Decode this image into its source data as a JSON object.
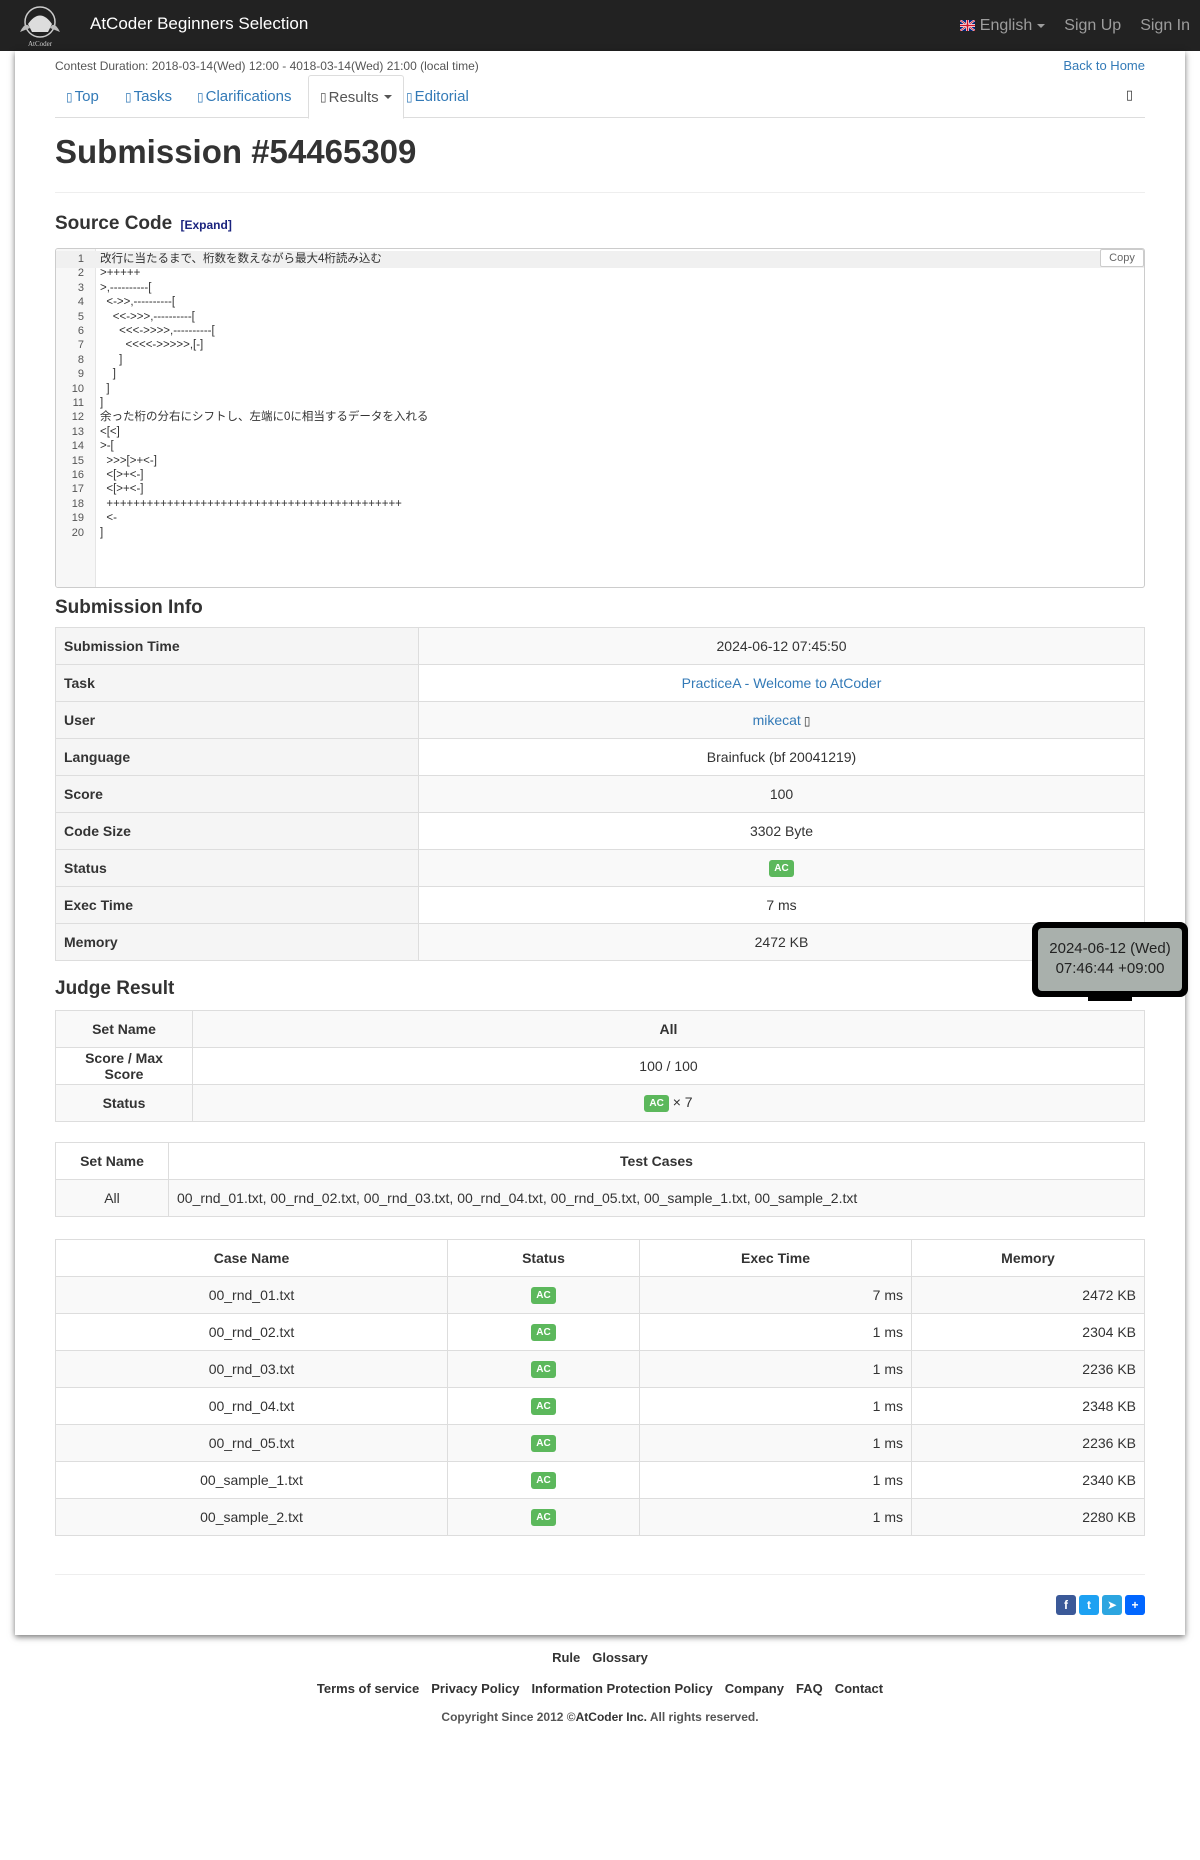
{
  "nav": {
    "brand": "AtCoder Beginners Selection",
    "logo_text": "AtCoder",
    "language": "English",
    "sign_up": "Sign Up",
    "sign_in": "Sign In"
  },
  "contest": {
    "duration": "Contest Duration: 2018-03-14(Wed) 12:00 - 4018-03-14(Wed) 21:00 (local time)",
    "back_home": "Back to Home"
  },
  "tabs": [
    {
      "label": "Top"
    },
    {
      "label": "Tasks"
    },
    {
      "label": "Clarifications"
    },
    {
      "label": "Results"
    },
    {
      "label": "Editorial"
    }
  ],
  "page_title": "Submission #54465309",
  "source": {
    "heading": "Source Code",
    "expand": "[Expand]",
    "copy": "Copy",
    "lines": [
      "改行に当たるまで、桁数を数えながら最大4桁読み込む",
      ">+++++",
      ">,----------[",
      "  <->>,----------[",
      "    <<->>>,----------[",
      "      <<<->>>>,----------[",
      "        <<<<->>>>>,[-]",
      "      ]",
      "    ]",
      "  ]",
      "]",
      "余った桁の分右にシフトし、左端に0に相当するデータを入れる",
      "<[<]",
      ">-[",
      "  >>>[>+<-]",
      "  <[>+<-]",
      "  <[>+<-]",
      "  ++++++++++++++++++++++++++++++++++++++++++++",
      "  <-",
      "]"
    ]
  },
  "submission_info": {
    "heading": "Submission Info",
    "rows": [
      {
        "label": "Submission Time",
        "value": "2024-06-12 07:45:50"
      },
      {
        "label": "Task",
        "value": "PracticeA - Welcome to AtCoder"
      },
      {
        "label": "User",
        "value": "mikecat"
      },
      {
        "label": "Language",
        "value": "Brainfuck (bf 20041219)"
      },
      {
        "label": "Score",
        "value": "100"
      },
      {
        "label": "Code Size",
        "value": "3302 Byte"
      },
      {
        "label": "Status",
        "value": "AC"
      },
      {
        "label": "Exec Time",
        "value": "7 ms"
      },
      {
        "label": "Memory",
        "value": "2472 KB"
      }
    ]
  },
  "judge": {
    "heading": "Judge Result",
    "set_name_label": "Set Name",
    "set_name": "All",
    "score_label": "Score / Max Score",
    "score": "100 / 100",
    "status_label": "Status",
    "status": "AC",
    "status_count": "× 7"
  },
  "test_sets": {
    "set_name_label": "Set Name",
    "test_cases_label": "Test Cases",
    "set_name": "All",
    "test_cases": "00_rnd_01.txt, 00_rnd_02.txt, 00_rnd_03.txt, 00_rnd_04.txt, 00_rnd_05.txt, 00_sample_1.txt, 00_sample_2.txt"
  },
  "cases": {
    "headers": [
      "Case Name",
      "Status",
      "Exec Time",
      "Memory"
    ],
    "rows": [
      {
        "name": "00_rnd_01.txt",
        "status": "AC",
        "time": "7 ms",
        "memory": "2472 KB"
      },
      {
        "name": "00_rnd_02.txt",
        "status": "AC",
        "time": "1 ms",
        "memory": "2304 KB"
      },
      {
        "name": "00_rnd_03.txt",
        "status": "AC",
        "time": "1 ms",
        "memory": "2236 KB"
      },
      {
        "name": "00_rnd_04.txt",
        "status": "AC",
        "time": "1 ms",
        "memory": "2348 KB"
      },
      {
        "name": "00_rnd_05.txt",
        "status": "AC",
        "time": "1 ms",
        "memory": "2236 KB"
      },
      {
        "name": "00_sample_1.txt",
        "status": "AC",
        "time": "1 ms",
        "memory": "2340 KB"
      },
      {
        "name": "00_sample_2.txt",
        "status": "AC",
        "time": "1 ms",
        "memory": "2280 KB"
      }
    ]
  },
  "tooltip": {
    "line1": "2024-06-12 (Wed)",
    "line2": "07:46:44 +09:00"
  },
  "footer": {
    "links1": [
      "Rule",
      "Glossary"
    ],
    "links2": [
      "Terms of service",
      "Privacy Policy",
      "Information Protection Policy",
      "Company",
      "FAQ",
      "Contact"
    ],
    "copyright_prefix": "Copyright Since 2012 ©",
    "copyright_company": "AtCoder Inc.",
    "copyright_suffix": " All rights reserved."
  },
  "colors": {
    "navbar": "#222222",
    "link": "#337ab7",
    "ac_badge": "#5cb85c"
  },
  "icons": [
    "atcoder-logo",
    "uk-flag-icon",
    "home-icon",
    "tasks-icon",
    "clarifications-icon",
    "results-icon",
    "editorial-icon",
    "user-icon",
    "facebook-icon",
    "twitter-icon",
    "telegram-icon",
    "share-icon"
  ]
}
